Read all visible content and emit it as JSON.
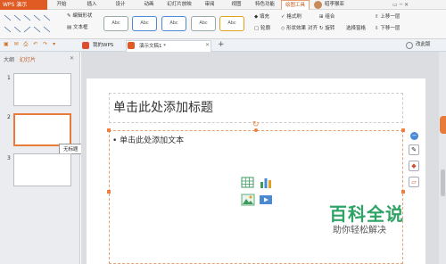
{
  "menubar": {
    "app_button": "WPS 演示",
    "tabs": [
      "开始",
      "插入",
      "设计",
      "动画",
      "幻灯片放映",
      "审阅",
      "视图",
      "特色功能",
      "绘图工具"
    ],
    "user_label": "昭李猴亚"
  },
  "ribbon": {
    "edit_shape": "编辑形状",
    "textbox": "文本框",
    "style_label": "Abc",
    "fill": "填充",
    "format_painter": "格式刷",
    "outline": "轮廓",
    "shape_effect": "形状效果",
    "group": "组合",
    "rotate": "旋转",
    "align": "对齐",
    "select_pane": "选择窗格",
    "move_up": "上移一层",
    "move_down": "下移一层"
  },
  "toolbar": {
    "my_wps_tab": "我的WPS",
    "doc_tab": "演示文稿1 *",
    "add_tab": "+",
    "feedback": "改此版"
  },
  "left_panel": {
    "tabs": [
      "大纲",
      "幻灯片"
    ],
    "thumbs": [
      "1",
      "2",
      "3"
    ],
    "tooltip": "无标题"
  },
  "slide": {
    "title_placeholder": "单击此处添加标题",
    "body_placeholder": "• 单击此处添加文本"
  },
  "watermark": {
    "title": "百科全说",
    "subtitle": "助你轻松解决"
  }
}
